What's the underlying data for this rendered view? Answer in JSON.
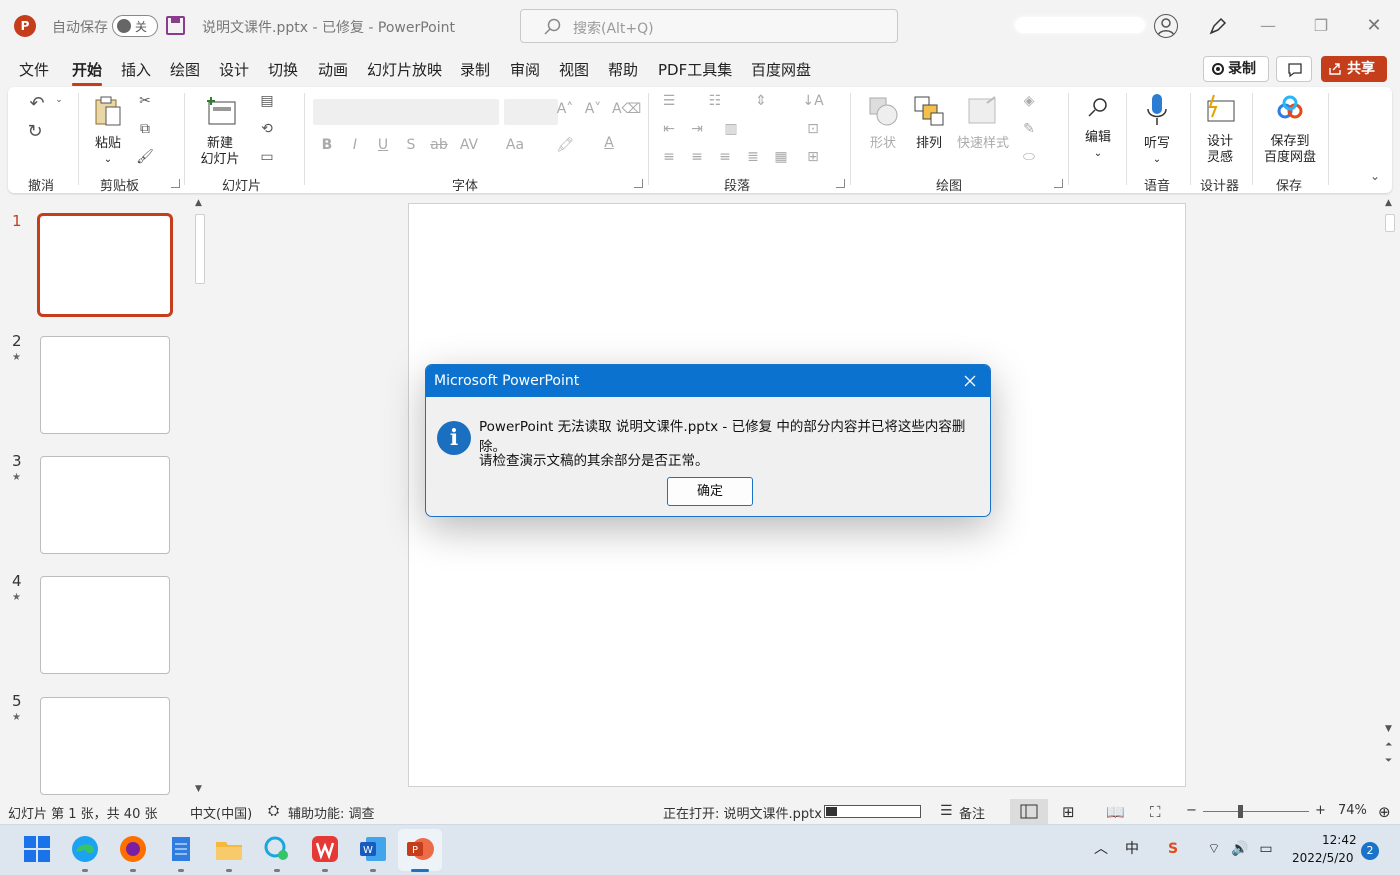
{
  "titlebar": {
    "app_logo": "P",
    "autosave_label": "自动保存",
    "autosave_state": "关",
    "doc_title": "说明文课件.pptx  -  已修复  -  PowerPoint",
    "search_placeholder": "搜索(Alt+Q)"
  },
  "menu": {
    "tabs": [
      "文件",
      "开始",
      "插入",
      "绘图",
      "设计",
      "切换",
      "动画",
      "幻灯片放映",
      "录制",
      "审阅",
      "视图",
      "帮助",
      "PDF工具集",
      "百度网盘"
    ],
    "active_tab": "开始",
    "record_label": "录制",
    "share_label": "共享"
  },
  "ribbon": {
    "groups": {
      "undo": "撤消",
      "clipboard": "剪贴板",
      "slides": "幻灯片",
      "font": "字体",
      "paragraph": "段落",
      "drawing": "绘图",
      "voice": "语音",
      "designer": "设计器",
      "save": "保存"
    },
    "paste_label": "粘贴",
    "new_slide_line1": "新建",
    "new_slide_line2": "幻灯片",
    "shape_label": "形状",
    "arrange_label": "排列",
    "quick_style_label": "快速样式",
    "edit_label": "编辑",
    "dictate_label": "听写",
    "designer_line1": "设计",
    "designer_line2": "灵感",
    "baidu_line1": "保存到",
    "baidu_line2": "百度网盘",
    "font_buttons": [
      "B",
      "I",
      "U",
      "S",
      "ab",
      "AV",
      "Aa",
      "A"
    ]
  },
  "thumbnails": {
    "numbers": [
      "1",
      "2",
      "3",
      "4",
      "5"
    ],
    "star": "★",
    "selected": 1
  },
  "dialog": {
    "title": "Microsoft PowerPoint",
    "message_line1": "PowerPoint 无法读取 说明文课件.pptx  -  已修复 中的部分内容并已将这些内容删除。",
    "message_line2": "请检查演示文稿的其余部分是否正常。",
    "ok_label": "确定",
    "icon": "i"
  },
  "statusbar": {
    "slide_info": "幻灯片 第 1 张，共 40 张",
    "language": "中文(中国)",
    "accessibility": "辅助功能: 调查",
    "opening_text": "正在打开: 说明文课件.pptx",
    "progress_fraction": 0.12,
    "notes_label": "备注",
    "zoom": "74%",
    "zoom_minus": "−",
    "zoom_plus": "+"
  },
  "taskbar": {
    "ime": "中",
    "time": "12:42",
    "date": "2022/5/20",
    "notifications": "2"
  },
  "colors": {
    "accent": "#c43e1c",
    "dialog_title_bg": "#0b72cf",
    "info_icon": "#1a6fc0"
  }
}
